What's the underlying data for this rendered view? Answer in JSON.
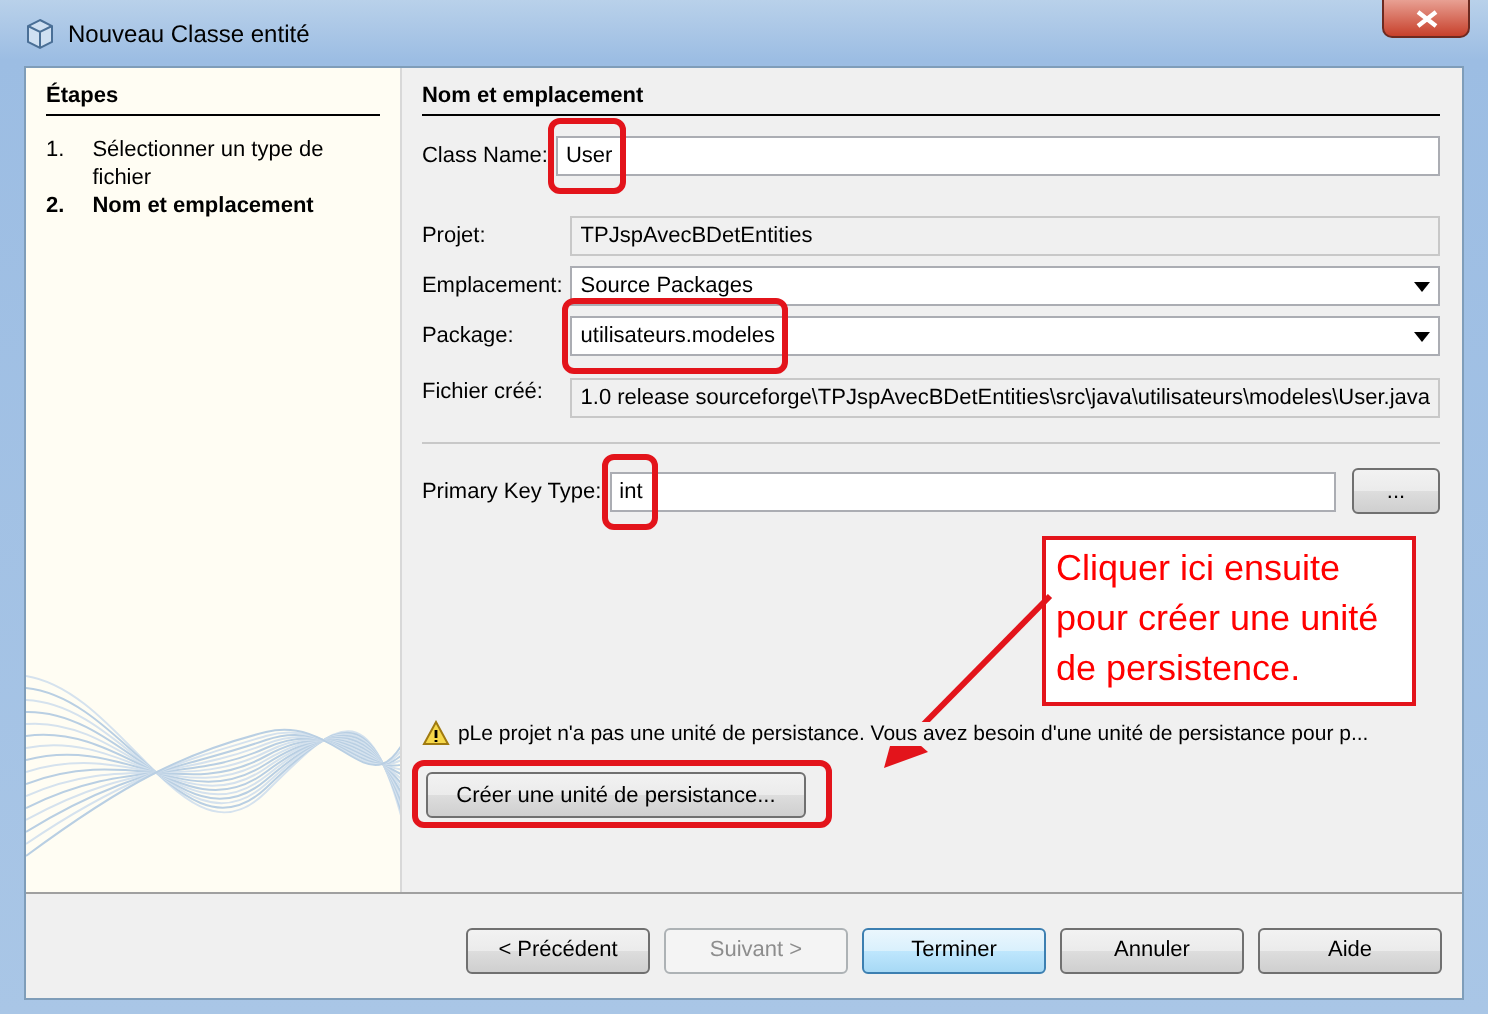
{
  "window": {
    "title": "Nouveau Classe entité"
  },
  "steps": {
    "heading": "Étapes",
    "items": [
      {
        "number": "1.",
        "label": "Sélectionner un type de fichier",
        "selected": false
      },
      {
        "number": "2.",
        "label": "Nom et emplacement",
        "selected": true
      }
    ]
  },
  "form": {
    "heading": "Nom et emplacement",
    "class_name": {
      "label": "Class Name:",
      "value": "User",
      "highlighted": true
    },
    "details": [
      {
        "kind": "readonly",
        "label": "Projet:",
        "value": "TPJspAvecBDetEntities",
        "highlighted": false
      },
      {
        "kind": "combo",
        "label": "Emplacement:",
        "value": "Source Packages",
        "highlighted": false
      },
      {
        "kind": "combo",
        "label": "Package:",
        "value": "utilisateurs.modeles",
        "highlighted": true
      },
      {
        "kind": "readonly",
        "label": "Fichier créé:",
        "value": "1.0 release sourceforge\\TPJspAvecBDetEntities\\src\\java\\utilisateurs\\modeles\\User.java",
        "highlighted": false
      }
    ],
    "primary_key": {
      "label": "Primary Key Type:",
      "value": "int",
      "highlighted": true,
      "browse": "..."
    },
    "warning": "pLe projet n'a pas une unité de persistance. Vous avez  besoin d'une unité de persistance pour p...",
    "persistence_button": {
      "label": "Créer une unité de persistance...",
      "highlighted": true
    }
  },
  "annotation": {
    "text": "Cliquer ici ensuite pour créer une unité de persistence."
  },
  "buttons": [
    {
      "label": "< Précédent",
      "disabled": false,
      "default": false
    },
    {
      "label": "Suivant >",
      "disabled": true,
      "default": false
    },
    {
      "label": "Terminer",
      "disabled": false,
      "default": true
    },
    {
      "label": "Annuler",
      "disabled": false,
      "default": false
    },
    {
      "label": "Aide",
      "disabled": false,
      "default": false
    }
  ]
}
